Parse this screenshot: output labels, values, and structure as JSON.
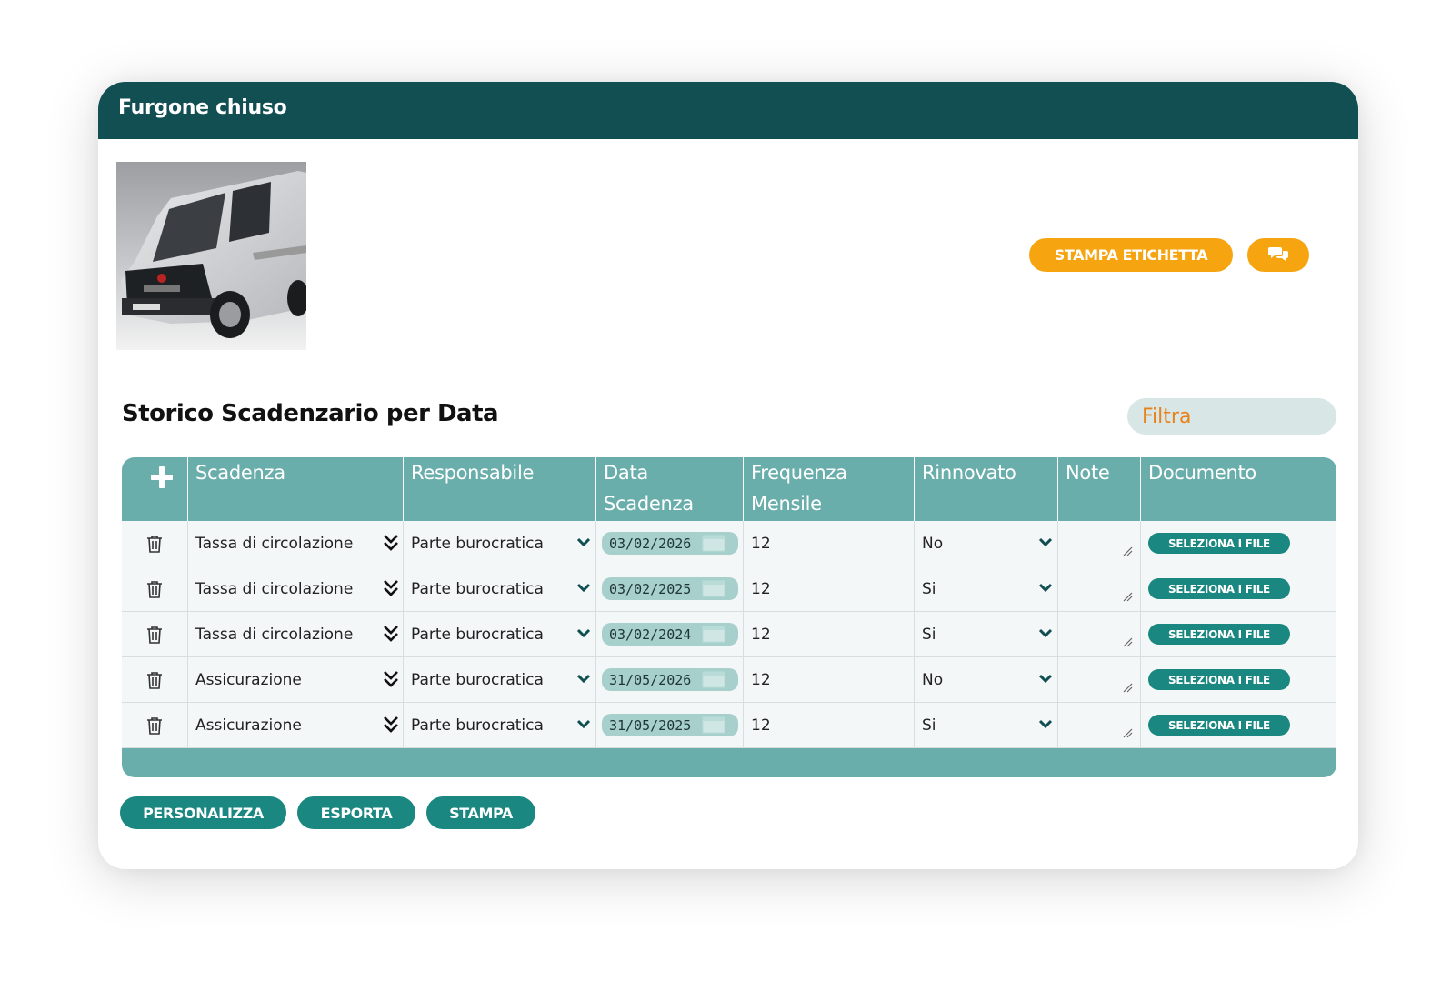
{
  "card": {
    "title": "Furgone chiuso"
  },
  "actions": {
    "print_label": "STAMPA ETICHETTA",
    "chat_icon": "chat-bubbles-icon"
  },
  "section": {
    "title": "Storico Scadenzario per Data"
  },
  "filter": {
    "placeholder": "Filtra"
  },
  "table": {
    "columns": [
      {
        "label": "Scadenza"
      },
      {
        "label": "Responsabile"
      },
      {
        "label": "Data Scadenza"
      },
      {
        "label": "Frequenza Mensile"
      },
      {
        "label": "Rinnovato"
      },
      {
        "label": "Note"
      },
      {
        "label": "Documento"
      }
    ],
    "rows": [
      {
        "scadenza": "Tassa di circolazione",
        "responsabile": "Parte burocratica",
        "data": "03/02/2026",
        "frequenza": "12",
        "rinnovato": "No",
        "documento": "SELEZIONA I FILE"
      },
      {
        "scadenza": "Tassa di circolazione",
        "responsabile": "Parte burocratica",
        "data": "03/02/2025",
        "frequenza": "12",
        "rinnovato": "Si",
        "documento": "SELEZIONA I FILE"
      },
      {
        "scadenza": "Tassa di circolazione",
        "responsabile": "Parte burocratica",
        "data": "03/02/2024",
        "frequenza": "12",
        "rinnovato": "Si",
        "documento": "SELEZIONA I FILE"
      },
      {
        "scadenza": "Assicurazione",
        "responsabile": "Parte burocratica",
        "data": "31/05/2026",
        "frequenza": "12",
        "rinnovato": "No",
        "documento": "SELEZIONA I FILE"
      },
      {
        "scadenza": "Assicurazione",
        "responsabile": "Parte burocratica",
        "data": "31/05/2025",
        "frequenza": "12",
        "rinnovato": "Si",
        "documento": "SELEZIONA I FILE"
      }
    ]
  },
  "footer": {
    "customize": "PERSONALIZZA",
    "export": "ESPORTA",
    "print": "STAMPA"
  },
  "colors": {
    "header": "#124f53",
    "table_header": "#6aaeab",
    "accent_orange": "#f6a511",
    "accent_teal": "#1a8780",
    "filter_text": "#e9821a"
  }
}
